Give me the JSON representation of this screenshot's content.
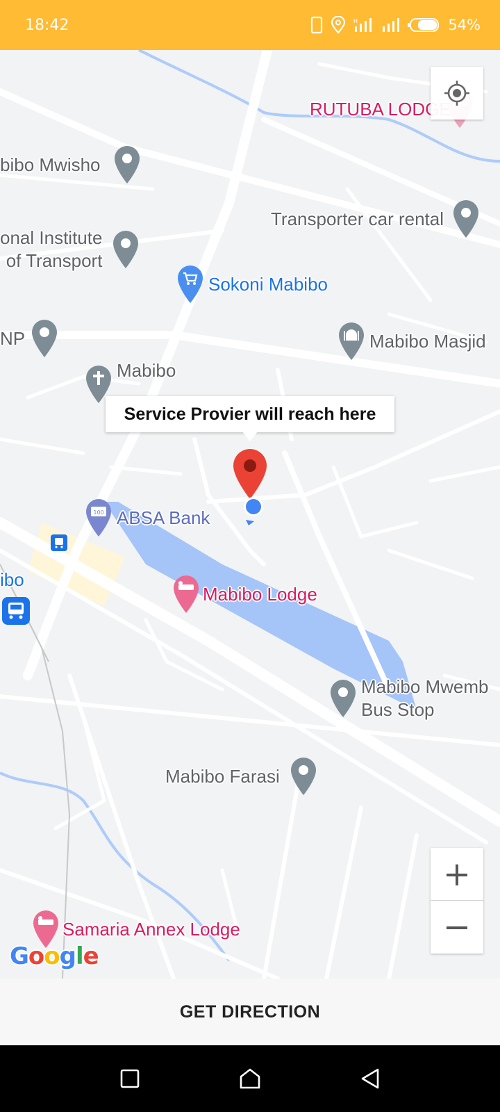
{
  "status_bar": {
    "time": "18:42",
    "battery": "54%",
    "icons": [
      "phone-icon",
      "location-icon",
      "signal-icon",
      "signal-icon",
      "battery-icon"
    ]
  },
  "map": {
    "pois": [
      {
        "name": "poi-rutuba-lodge",
        "label": "RUTUBA LODGE",
        "icon": "hotel-pin-icon",
        "color": "pink"
      },
      {
        "name": "poi-mabibo-mwisho",
        "label": "bibo Mwisho",
        "icon": "place-pin-icon",
        "color": "gray"
      },
      {
        "name": "poi-transporter-car-rental",
        "label": "Transporter car rental",
        "icon": "place-pin-icon",
        "color": "gray"
      },
      {
        "name": "poi-national-institute",
        "label_line1": "onal Institute",
        "label_line2": "of Transport",
        "icon": "place-pin-icon",
        "color": "gray"
      },
      {
        "name": "poi-sokoni-mabibo",
        "label": "Sokoni Mabibo",
        "icon": "shopping-cart-pin-icon",
        "color": "blue"
      },
      {
        "name": "poi-np",
        "label": "NP",
        "icon": "place-pin-icon",
        "color": "gray"
      },
      {
        "name": "poi-mabibo-masjid",
        "label": "Mabibo Masjid",
        "icon": "mosque-pin-icon",
        "color": "gray"
      },
      {
        "name": "poi-mabibo-church",
        "label": "Mabibo",
        "icon": "church-pin-icon",
        "color": "gray"
      },
      {
        "name": "poi-absa-bank",
        "label": "ABSA Bank",
        "icon": "bank-pin-icon",
        "color": "purple"
      },
      {
        "name": "poi-bibo",
        "label": "ibo",
        "icon": "",
        "color": "blue"
      },
      {
        "name": "poi-mabibo-lodge",
        "label": "Mabibo Lodge",
        "icon": "hotel-pin-icon",
        "color": "pink"
      },
      {
        "name": "poi-mabibo-mwembe-bus-stop",
        "label_line1": "Mabibo Mwemb",
        "label_line2": "Bus Stop",
        "icon": "place-pin-icon",
        "color": "gray"
      },
      {
        "name": "poi-mabibo-farasi",
        "label": "Mabibo Farasi",
        "icon": "place-pin-icon",
        "color": "gray"
      },
      {
        "name": "poi-samaria-annex-lodge",
        "label": "Samaria Annex Lodge",
        "icon": "hotel-pin-icon",
        "color": "pink"
      }
    ],
    "callout_text": "Service Provier will reach here",
    "marker": "red-location-marker-icon",
    "current_location": "blue-dot-icon",
    "zoom_in_symbol": "+",
    "zoom_out_symbol": "−",
    "logo": [
      "G",
      "o",
      "o",
      "g",
      "l",
      "e"
    ]
  },
  "action": {
    "direction_label": "GET DIRECTION"
  },
  "nav": {
    "buttons": [
      "recents-square-icon",
      "home-icon",
      "back-triangle-icon"
    ]
  },
  "colors": {
    "status_bar": "#FFBB33",
    "map_background": "#F1F3F4",
    "marker_red": "#EA4335",
    "location_blue": "#4285F4",
    "area_blue": "#A5C4F7"
  }
}
